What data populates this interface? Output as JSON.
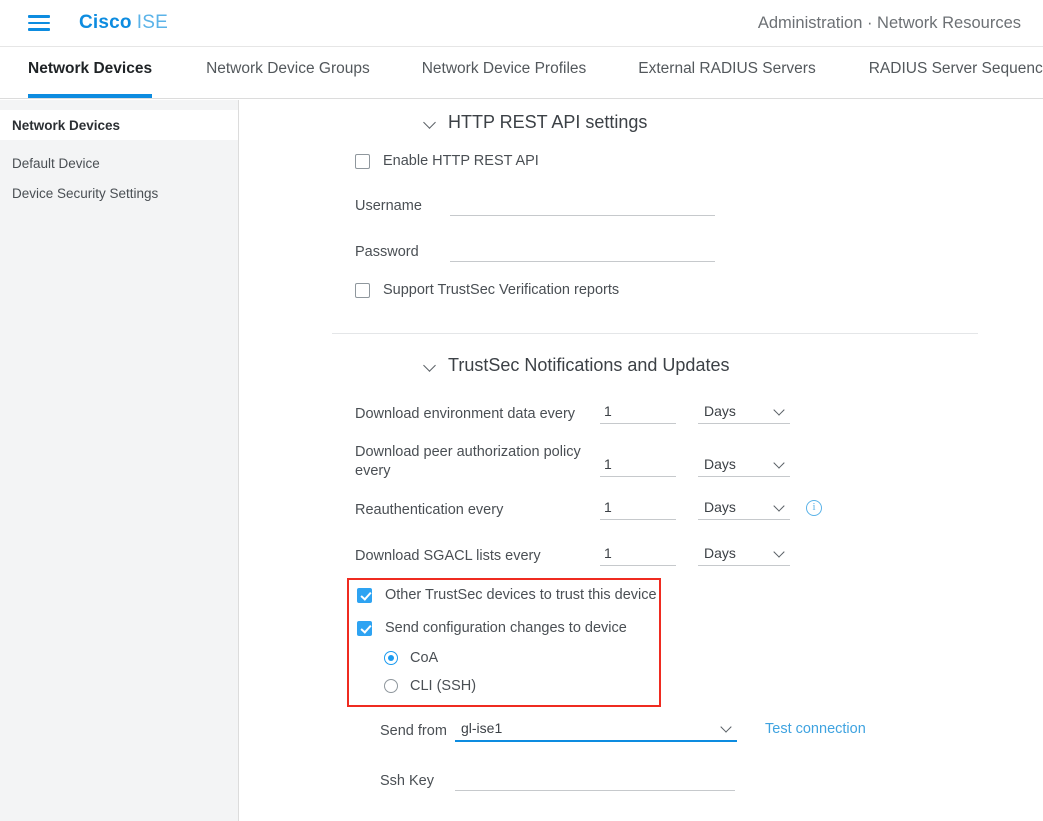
{
  "header": {
    "menu_icon": "hamburger-icon",
    "brand_primary": "Cisco",
    "brand_secondary": "ISE",
    "breadcrumb": "Administration · Network Resources"
  },
  "tabs": [
    {
      "label": "Network Devices",
      "active": true
    },
    {
      "label": "Network Device Groups",
      "active": false
    },
    {
      "label": "Network Device Profiles",
      "active": false
    },
    {
      "label": "External RADIUS Servers",
      "active": false
    },
    {
      "label": "RADIUS Server Sequences",
      "active": false
    }
  ],
  "sidebar": {
    "items": [
      {
        "label": "Network Devices",
        "selected": true
      },
      {
        "label": "Default Device",
        "selected": false
      },
      {
        "label": "Device Security Settings",
        "selected": false
      }
    ]
  },
  "http_rest_api": {
    "title": "HTTP REST API settings",
    "enable_label": "Enable HTTP REST API",
    "enable_checked": false,
    "username_label": "Username",
    "username_value": "",
    "password_label": "Password",
    "password_value": "",
    "support_label": "Support TrustSec Verification reports",
    "support_checked": false
  },
  "trustsec": {
    "title": "TrustSec Notifications and Updates",
    "intervals": [
      {
        "label": "Download environment data every",
        "value": "1",
        "unit": "Days",
        "info": false
      },
      {
        "label": "Download peer authorization policy every",
        "value": "1",
        "unit": "Days",
        "info": false
      },
      {
        "label": "Reauthentication every",
        "value": "1",
        "unit": "Days",
        "info": true
      },
      {
        "label": "Download SGACL lists every",
        "value": "1",
        "unit": "Days",
        "info": false
      }
    ],
    "trust_device_label": "Other TrustSec devices to trust this device",
    "trust_device_checked": true,
    "send_config_label": "Send configuration changes to device",
    "send_config_checked": true,
    "send_mode_options": [
      {
        "label": "CoA",
        "selected": true
      },
      {
        "label": "CLI (SSH)",
        "selected": false
      }
    ],
    "send_from_label": "Send from",
    "send_from_value": "gl-ise1",
    "test_connection_label": "Test connection",
    "ssh_key_label": "Ssh Key",
    "ssh_key_value": ""
  },
  "colors": {
    "brand_blue": "#0d8ce0",
    "brand_light_blue": "#5bb3e8",
    "accent_check": "#2ea3f2",
    "highlight_red": "#ef2b20",
    "link_blue": "#3fa3e0"
  }
}
